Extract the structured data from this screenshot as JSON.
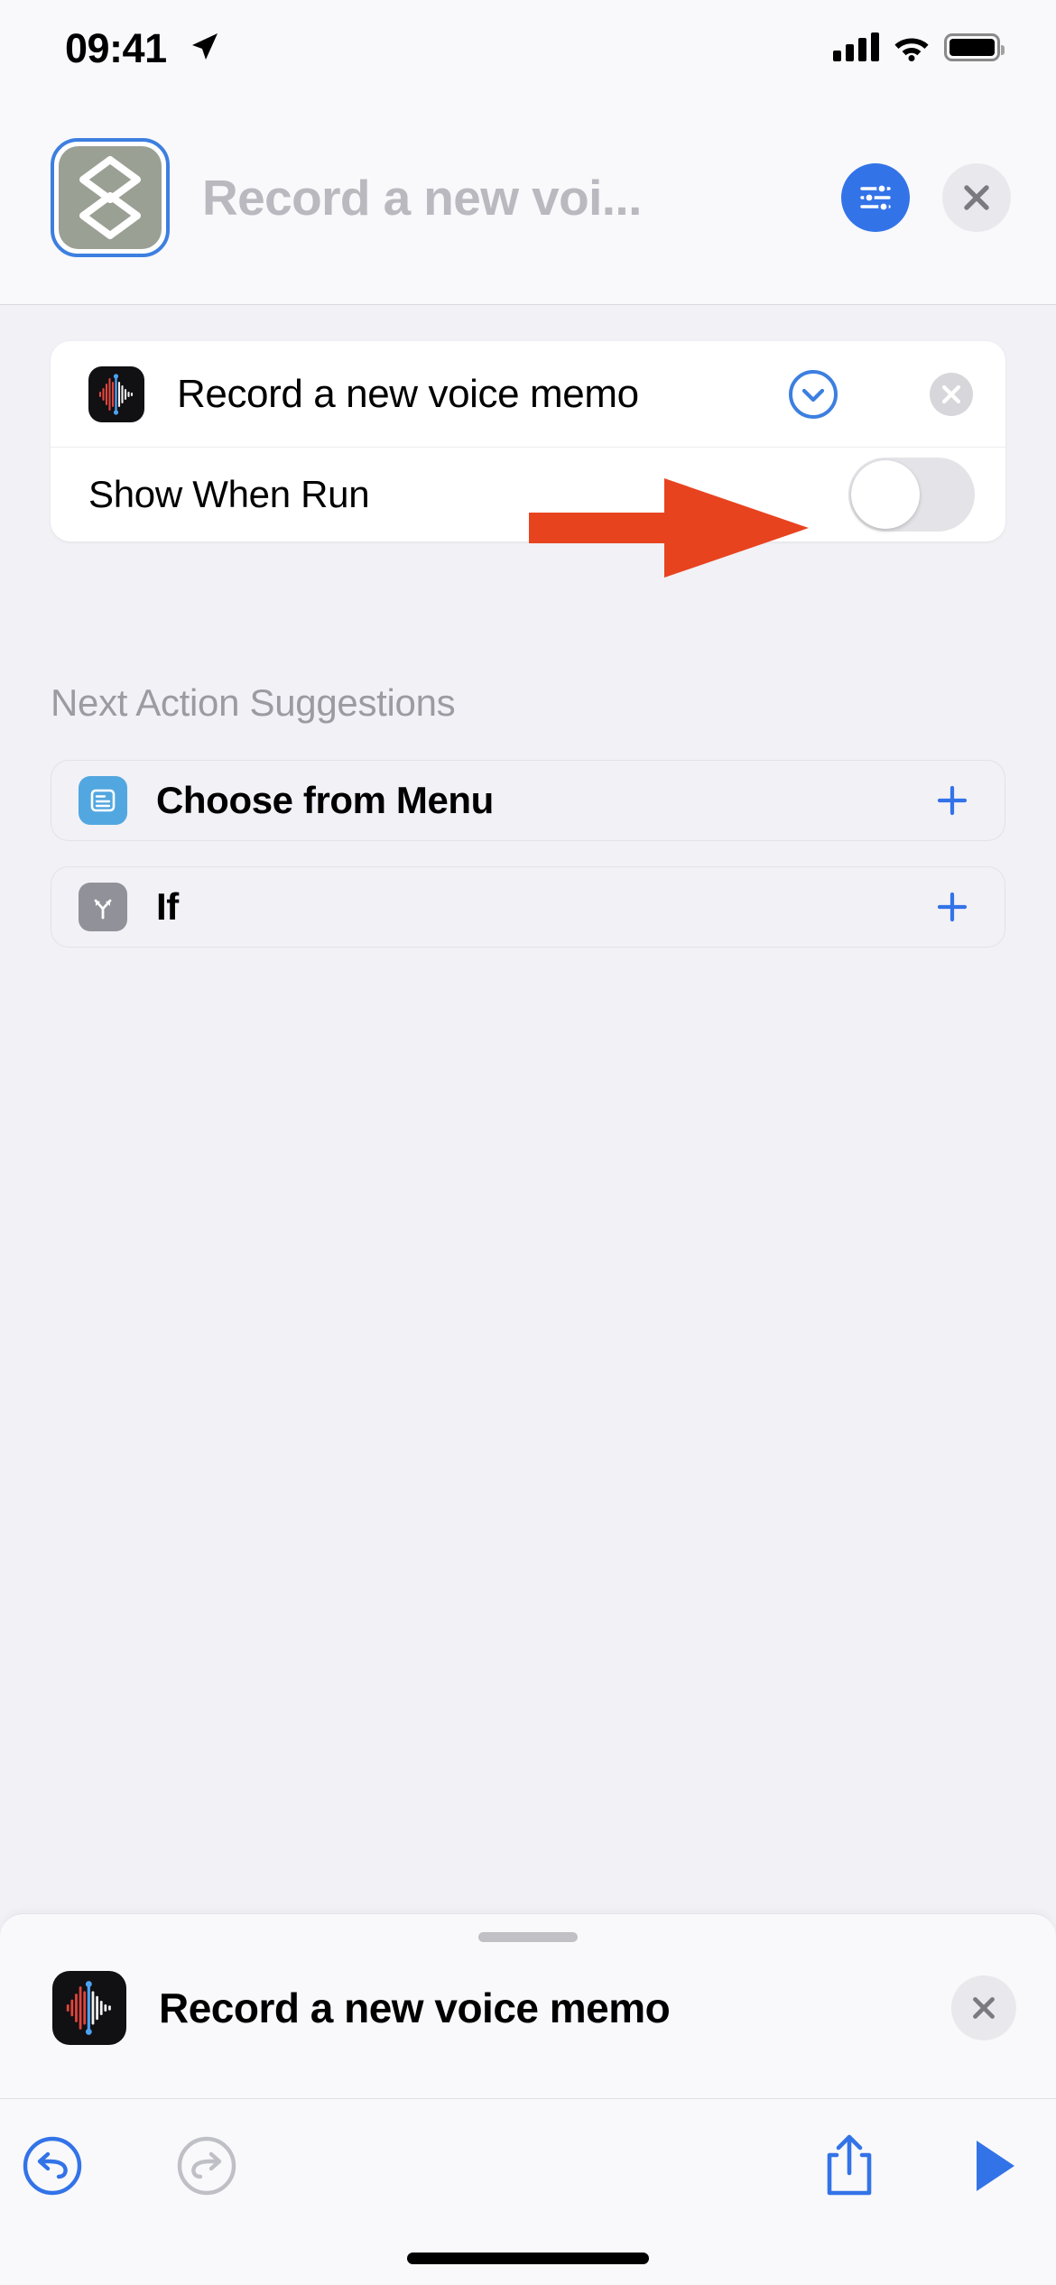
{
  "status_bar": {
    "time": "09:41",
    "location_icon": "location-arrow-icon",
    "cellular_icon": "cellular-bars-icon",
    "wifi_icon": "wifi-icon",
    "battery_icon": "battery-full-icon"
  },
  "header": {
    "shortcut_icon": "shortcuts-layers-icon",
    "title": "Record a new voi...",
    "settings_icon": "sliders-settings-icon",
    "close_icon": "close-x-icon",
    "accent_blue": "#3373e8",
    "icon_background": "#9aa094",
    "focus_ring": "#3d7fe0"
  },
  "action_card": {
    "app_icon": "voice-memos-waveform-icon",
    "title": "Record a new voice memo",
    "expand_icon": "chevron-down-circle-icon",
    "remove_icon": "remove-circle-x-icon",
    "parameter": {
      "label": "Show When Run",
      "toggle_state": "off",
      "toggle_track_color": "#e4e4e8"
    }
  },
  "annotation": {
    "type": "arrow",
    "color": "#e8431f",
    "points_to": "Show When Run toggle"
  },
  "suggestions": {
    "heading": "Next Action Suggestions",
    "items": [
      {
        "label": "Choose from Menu",
        "icon": "menu-list-icon",
        "icon_color": "#52a7e0",
        "add_icon": "plus-icon"
      },
      {
        "label": "If",
        "icon": "branch-split-icon",
        "icon_color": "#91919a",
        "add_icon": "plus-icon"
      }
    ]
  },
  "bottom_sheet": {
    "handle": "drag-handle",
    "app_icon": "voice-memos-waveform-icon",
    "title": "Record a new voice memo",
    "close_icon": "close-x-icon"
  },
  "toolbar": {
    "undo_icon": "undo-arrow-icon",
    "undo_enabled": "enabled",
    "redo_icon": "redo-arrow-icon",
    "redo_enabled": "disabled",
    "share_icon": "share-upload-icon",
    "run_icon": "play-triangle-icon",
    "active_color": "#3373e8",
    "disabled_color": "#bfbfc6"
  },
  "home_indicator": "home-indicator-bar"
}
